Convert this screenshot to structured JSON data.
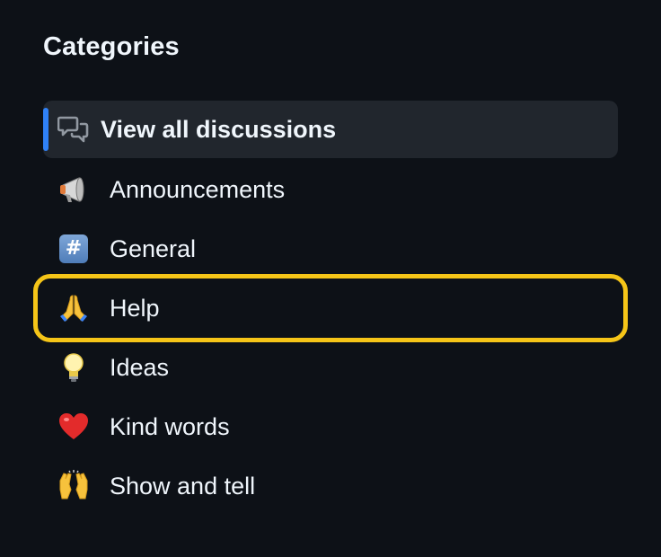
{
  "sidebar": {
    "heading": "Categories",
    "items": [
      {
        "label": "View all discussions",
        "icon": "discussions-icon",
        "active": true
      },
      {
        "label": "Announcements",
        "icon": "megaphone-icon"
      },
      {
        "label": "General",
        "icon": "hash-icon",
        "icon_text": "#"
      },
      {
        "label": "Help",
        "icon": "folded-hands-icon",
        "highlighted": true
      },
      {
        "label": "Ideas",
        "icon": "lightbulb-icon"
      },
      {
        "label": "Kind words",
        "icon": "heart-icon"
      },
      {
        "label": "Show and tell",
        "icon": "raised-hands-icon"
      }
    ]
  },
  "colors": {
    "background": "#0d1117",
    "active_bg": "#21262d",
    "active_indicator": "#2f81f7",
    "highlight_outline": "#f5c518",
    "text": "#f0f6fc"
  }
}
